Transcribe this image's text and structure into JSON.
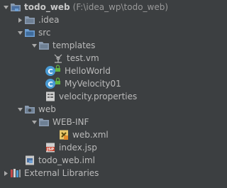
{
  "tree": {
    "root": {
      "name": "todo_web",
      "path": "(F:\\idea_wp\\todo_web)"
    },
    "idea": ".idea",
    "src": "src",
    "templates": "templates",
    "test_vm": "test.vm",
    "hello_world": "HelloWorld",
    "my_velocity": "MyVelocity01",
    "velocity_props": "velocity.properties",
    "web": "web",
    "web_inf": "WEB-INF",
    "web_xml": "web.xml",
    "index_jsp": "index.jsp",
    "iml": "todo_web.iml",
    "ext_libs": "External Libraries"
  },
  "colors": {
    "background": "#3c3f41",
    "text": "#bbbbbb",
    "folder": "#8a9bb0",
    "source_folder": "#6fa0d4",
    "class": "#4a9bd4"
  },
  "icons": {
    "expanded": "chevron-down-icon",
    "collapsed": "chevron-right-icon"
  }
}
